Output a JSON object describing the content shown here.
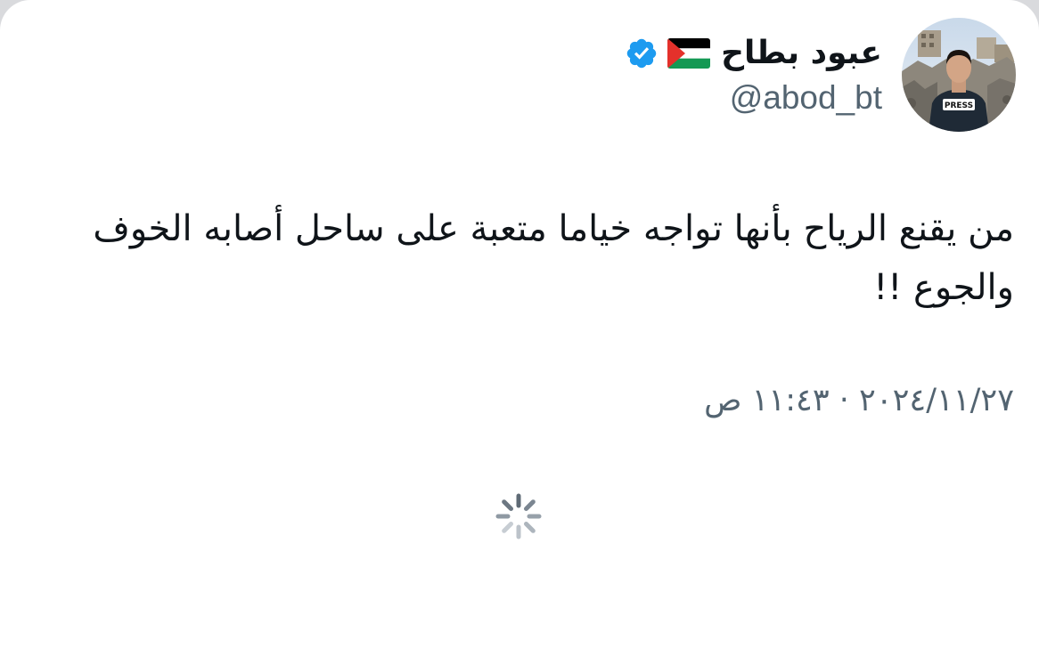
{
  "tweet": {
    "author": {
      "display_name": "عبود بطاح",
      "handle": "@abod_bt",
      "flag_icon": "palestine-flag-icon",
      "verified_icon": "verified-badge-icon",
      "avatar_press_label": "PRESS"
    },
    "text": "من يقنع الرياح بأنها تواجه خياما متعبة على ساحل أصابه الخوف والجوع !!",
    "timestamp": "٢٠٢٤/١١/٢٧ · ١١:٤٣ ص"
  },
  "loading": {
    "icon": "loading-spinner-icon"
  },
  "colors": {
    "verified_blue": "#1d9bf0",
    "text_primary": "#0f1419",
    "text_secondary": "#536471",
    "background": "#ffffff",
    "flag_black": "#000000",
    "flag_white": "#ffffff",
    "flag_green": "#149954",
    "flag_red": "#e4312b"
  }
}
